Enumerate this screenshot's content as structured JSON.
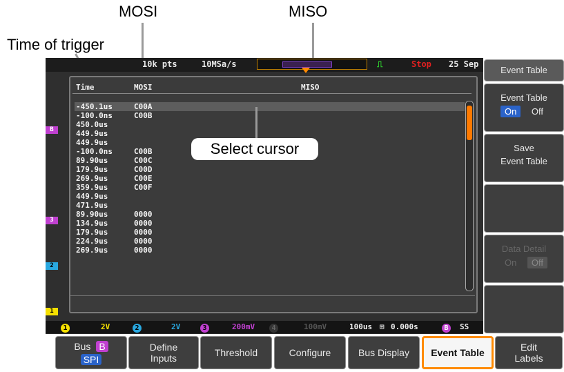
{
  "callouts": {
    "mosi": "MOSI",
    "miso": "MISO",
    "time_of_trigger": "Time of trigger",
    "select_cursor": "Select cursor"
  },
  "topbar": {
    "record": "10k pts",
    "sample_rate": "10MSa/s",
    "status": "Stop",
    "date": "25 Sep"
  },
  "table": {
    "headers": {
      "time": "Time",
      "mosi": "MOSI",
      "miso": "MISO"
    },
    "rows": [
      {
        "time": "-450.1us",
        "mosi": "C00A"
      },
      {
        "time": "-100.0ns",
        "mosi": "C00B"
      },
      {
        "time": "450.0us",
        "mosi": ""
      },
      {
        "time": "449.9us",
        "mosi": ""
      },
      {
        "time": "449.9us",
        "mosi": ""
      },
      {
        "time": "-100.0ns",
        "mosi": "C00B"
      },
      {
        "time": "89.90us",
        "mosi": "C00C"
      },
      {
        "time": "179.9us",
        "mosi": "C00D"
      },
      {
        "time": "269.9us",
        "mosi": "C00E"
      },
      {
        "time": "359.9us",
        "mosi": "C00F"
      },
      {
        "time": "449.9us",
        "mosi": ""
      },
      {
        "time": "471.9us",
        "mosi": ""
      },
      {
        "time": "89.90us",
        "mosi": "0000"
      },
      {
        "time": "134.9us",
        "mosi": "0000"
      },
      {
        "time": "179.9us",
        "mosi": "0000"
      },
      {
        "time": "224.9us",
        "mosi": "0000"
      },
      {
        "time": "269.9us",
        "mosi": "0000"
      }
    ]
  },
  "channels": {
    "ch1": "1",
    "ch2": "2",
    "ch3": "3",
    "chB": "B"
  },
  "statusbar": {
    "ch1_label": "1",
    "ch1_val": "2V",
    "ch2_label": "2",
    "ch2_val": "2V",
    "ch3_label": "3",
    "ch3_val": "200mV",
    "ch4_label": "4",
    "ch4_val": "100mV",
    "timebase": "100us",
    "position": "0.000s",
    "bus_label": "B",
    "trigger": "SS"
  },
  "sidebar": {
    "event_table_title": "Event Table",
    "event_table_toggle_label": "Event Table",
    "on": "On",
    "off": "Off",
    "save_line1": "Save",
    "save_line2": "Event Table",
    "detail_label": "Data Detail",
    "detail_on": "On",
    "detail_off": "Off"
  },
  "bottom_menu": {
    "bus_label": "Bus",
    "bus_badge": "B",
    "bus_sub": "SPI",
    "define_line1": "Define",
    "define_line2": "Inputs",
    "threshold": "Threshold",
    "configure": "Configure",
    "bus_display": "Bus Display",
    "event_table": "Event Table",
    "edit_line1": "Edit",
    "edit_line2": "Labels"
  },
  "colors": {
    "ch1": "#f6e000",
    "ch2": "#29a8e0",
    "ch3": "#c040d0",
    "bus": "#c040d0",
    "accent": "#ff8a00",
    "stop": "#e02020"
  }
}
